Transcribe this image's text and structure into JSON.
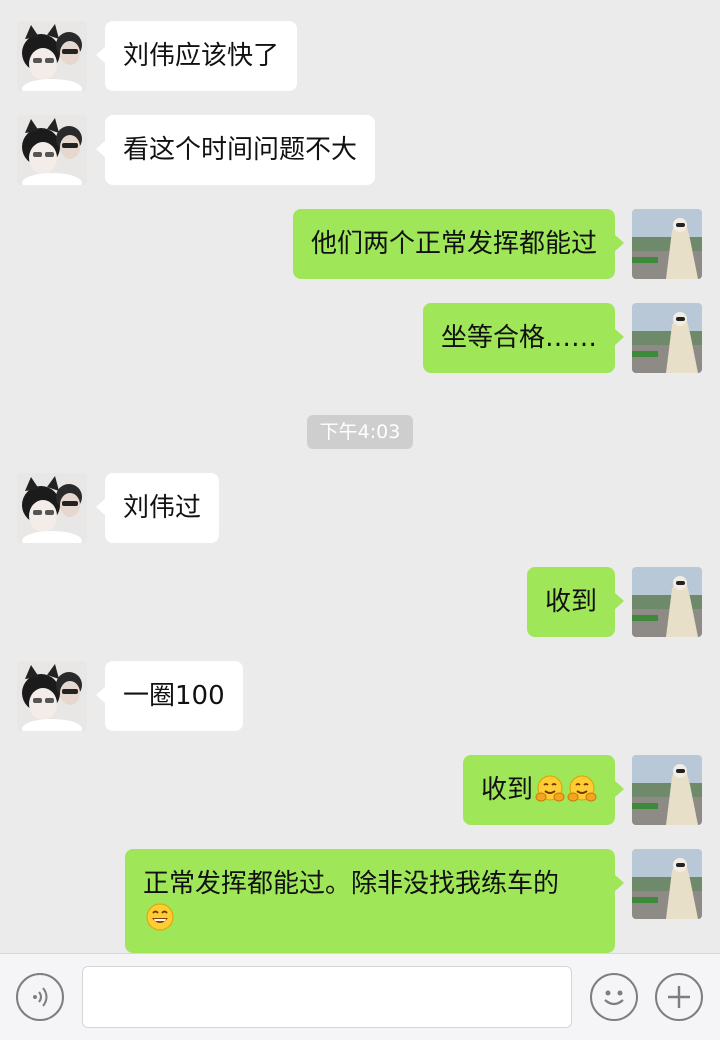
{
  "messages": [
    {
      "side": "in",
      "text": "刘伟应该快了"
    },
    {
      "side": "in",
      "text": "看这个时间问题不大"
    },
    {
      "side": "out",
      "text": "他们两个正常发挥都能过"
    },
    {
      "side": "out",
      "text": "坐等合格……"
    },
    {
      "side": "in",
      "text": "刘伟过"
    },
    {
      "side": "out",
      "text": "收到"
    },
    {
      "side": "in",
      "text": "一圈100"
    },
    {
      "side": "out",
      "text": "收到",
      "emojis": [
        "hug-emoji",
        "hug-emoji"
      ]
    },
    {
      "side": "out",
      "text": "正常发挥都能过。除非没找我练车的",
      "emojis": [
        "grin-emoji"
      ]
    }
  ],
  "timestamp": "下午4:03",
  "input_bar": {
    "voice_icon": "voice-icon",
    "emoji_icon": "emoji-icon",
    "add_icon": "plus-icon",
    "input_value": ""
  },
  "colors": {
    "background": "#ebebeb",
    "incoming_bubble": "#ffffff",
    "outgoing_bubble": "#9fe658"
  }
}
